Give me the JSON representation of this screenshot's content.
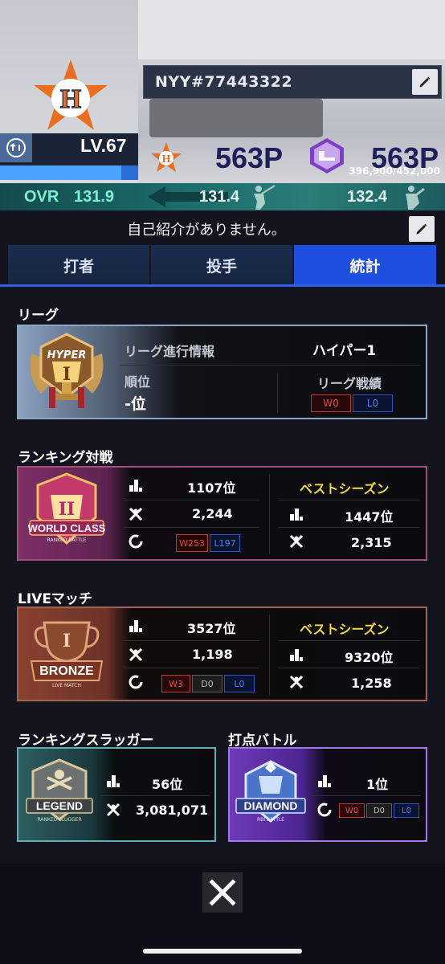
{
  "header": {
    "player_id": "NYY#77443322",
    "level": "LV.67",
    "exp": "396,900/452,000",
    "exp_fraction": 0.878,
    "points_team": "563P",
    "points_league": "563P",
    "ovr_label": "OVR",
    "ovr_value": "131.9",
    "batting_value": "131.4",
    "pitching_value": "132.4"
  },
  "intro": {
    "text": "自己紹介がありません。"
  },
  "tabs": [
    {
      "label": "打者"
    },
    {
      "label": "投手"
    },
    {
      "label": "統計"
    }
  ],
  "league": {
    "section_title": "リーグ",
    "badge_text": "HYPER",
    "badge_numeral": "I",
    "progress_label": "リーグ進行情報",
    "progress_value": "ハイパー1",
    "rank_label": "順位",
    "rank_value": "-位",
    "record_label": "リーグ戦績",
    "record_w": "W0",
    "record_l": "L0"
  },
  "ranked": {
    "section_title": "ランキング対戦",
    "badge_numeral": "II",
    "badge_text": "WORLD CLASS",
    "badge_sub": "RANKED BATTLE",
    "rank": "1107位",
    "score": "2,244",
    "record_w": "W253",
    "record_l": "L197",
    "best_label": "ベストシーズン",
    "best_rank": "1447位",
    "best_score": "2,315"
  },
  "live": {
    "section_title": "LIVEマッチ",
    "badge_numeral": "I",
    "badge_text": "BRONZE",
    "badge_sub": "LIVE MATCH",
    "rank": "3527位",
    "score": "1,198",
    "record_w": "W3",
    "record_d": "D0",
    "record_l": "L0",
    "best_label": "ベストシーズン",
    "best_rank": "9320位",
    "best_score": "1,258"
  },
  "slugger": {
    "section_title": "ランキングスラッガー",
    "badge_text": "LEGEND",
    "badge_sub": "RANKED SLUGGER",
    "rank": "56位",
    "score": "3,081,071"
  },
  "rbi": {
    "section_title": "打点バトル",
    "badge_text": "DIAMOND",
    "badge_sub": "RBI BATTLE",
    "rank": "1位",
    "record_w": "W0",
    "record_d": "D0",
    "record_l": "L0"
  },
  "colors": {
    "accent_tab": "#1f4fe0",
    "ovr_text": "#7ff0d0",
    "best_season": "#f1d83b",
    "win": "#e84545",
    "loss": "#4e7ef0"
  },
  "icons": [
    "houston-star-logo-icon",
    "edit-pencil-icon",
    "level-up-icon",
    "podium-rank-icon",
    "crossed-bats-icon",
    "record-circle-icon",
    "close-x-icon"
  ]
}
